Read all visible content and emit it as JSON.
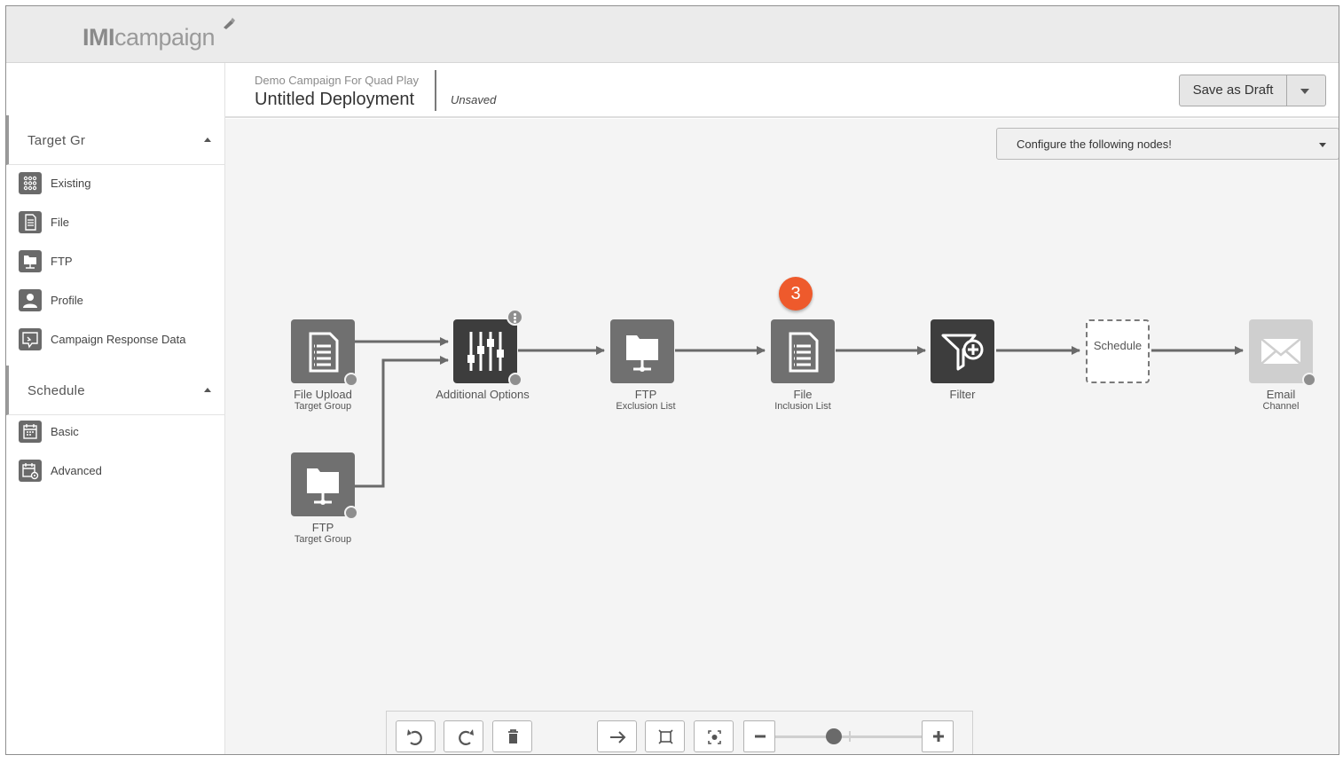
{
  "app": {
    "logo_bold": "IMI",
    "logo_rest": "campaign"
  },
  "sidebar": {
    "collapse_label": "«",
    "sections": [
      {
        "title": "Target Gr",
        "items": [
          {
            "label": "Existing",
            "icon": "grid-icon"
          },
          {
            "label": "File",
            "icon": "document-icon"
          },
          {
            "label": "FTP",
            "icon": "ftp-icon"
          },
          {
            "label": "Profile",
            "icon": "profile-icon"
          },
          {
            "label": "Campaign Response Data",
            "icon": "response-icon"
          }
        ]
      },
      {
        "title": "Schedule",
        "items": [
          {
            "label": "Basic",
            "icon": "calendar-icon"
          },
          {
            "label": "Advanced",
            "icon": "calendar-gear-icon"
          }
        ]
      }
    ]
  },
  "header": {
    "campaign": "Demo Campaign For Quad Play",
    "deployment": "Untitled Deployment",
    "status": "Unsaved",
    "save_label": "Save as Draft"
  },
  "config_dropdown": {
    "label": "Configure the following nodes!"
  },
  "badge": {
    "value": "3",
    "color": "#ee5a2c"
  },
  "nodes": {
    "file_upload": {
      "title": "File Upload",
      "sub": "Target Group"
    },
    "additional_options": {
      "title": "Additional Options"
    },
    "ftp_exclusion": {
      "title": "FTP",
      "sub": "Exclusion List"
    },
    "file_inclusion": {
      "title": "File",
      "sub": "Inclusion List"
    },
    "filter": {
      "title": "Filter"
    },
    "schedule": {
      "title": "Schedule"
    },
    "email": {
      "title": "Email",
      "sub": "Channel"
    },
    "ftp_target": {
      "title": "FTP",
      "sub": "Target Group"
    }
  },
  "toolbar": {
    "buttons": [
      "undo-icon",
      "redo-icon",
      "trash-icon",
      "arrow-right-icon",
      "fit-icon",
      "focus-icon"
    ],
    "zoom_level": 0.4
  }
}
